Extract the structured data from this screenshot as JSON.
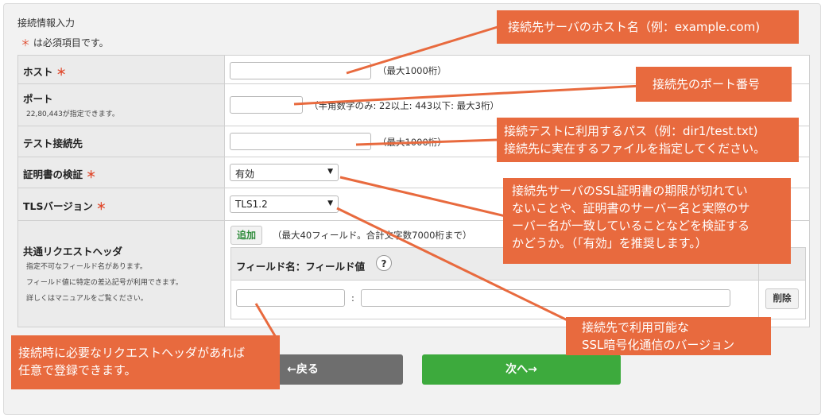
{
  "section_title": "接続情報入力",
  "required_note": "は必須項目です。",
  "required_mark": "＊",
  "fields": {
    "host": {
      "label": "ホスト",
      "hint": "（最大1000桁）"
    },
    "port": {
      "label": "ポート",
      "sub": "22,80,443が指定できます。",
      "hint": "（半角数字のみ: 22以上: 443以下: 最大3桁）"
    },
    "test_path": {
      "label": "テスト接続先",
      "hint": "（最大1000桁）"
    },
    "cert": {
      "label": "証明書の検証",
      "value": "有効"
    },
    "tls": {
      "label": "TLSバージョン",
      "value": "TLS1.2"
    },
    "headers": {
      "label": "共通リクエストヘッダ",
      "notes": [
        "指定不可なフィールド名があります。",
        "フィールド値に特定の差込記号が利用できます。",
        "詳しくはマニュアルをご覧ください。"
      ],
      "add_label": "追加",
      "limit_hint": "（最大40フィールド。合計文字数7000桁まで）",
      "column_header": "フィールド名：フィールド値",
      "help_label": "?",
      "separator": ":",
      "delete_label": "削除"
    }
  },
  "buttons": {
    "back": "←戻る",
    "next": "次へ→"
  },
  "callouts": {
    "host": "接続先サーバのホスト名（例：example.com)",
    "port": "接続先のポート番号",
    "test_path": [
      "接続テストに利用するパス（例：dir1/test.txt)",
      "接続先に実在するファイルを指定してください。"
    ],
    "cert": [
      "接続先サーバのSSL証明書の期限が切れてい",
      "ないことや、証明書のサーバー名と実際のサ",
      "ーバー名が一致していることなどを検証する",
      "かどうか。（「有効」を推奨します。）"
    ],
    "tls": [
      "接続先で利用可能な",
      "SSL暗号化通信のバージョン"
    ],
    "headers": [
      "接続時に必要なリクエストヘッダがあれば",
      "任意で登録できます。"
    ]
  },
  "colors": {
    "callout": "#e86a3e",
    "back_button": "#6e6e6e",
    "next_button": "#3daa3d",
    "required": "#e04b2f"
  }
}
